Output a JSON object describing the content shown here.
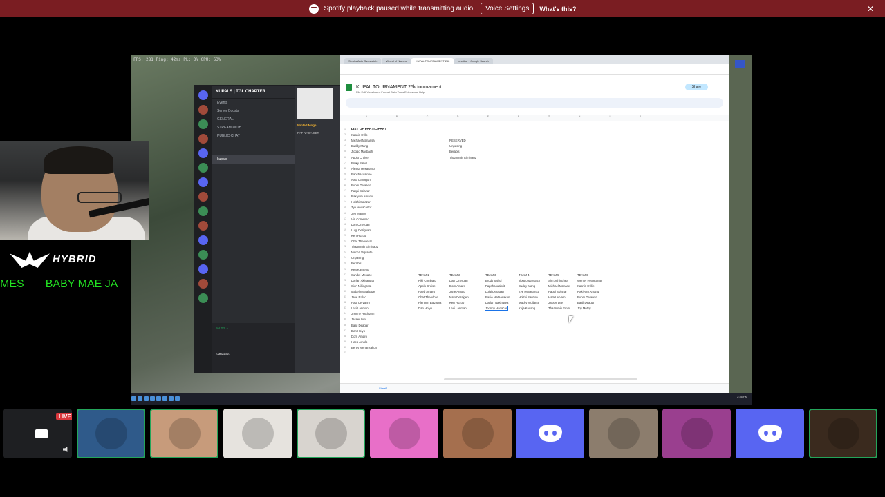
{
  "notice": {
    "message": "Spotify playback paused while transmitting audio.",
    "button_label": "Voice Settings",
    "link_label": "What's this?",
    "close_label": "✕"
  },
  "stream": {
    "stats_text": "FPS: 281    Ping: 42ms    PL: 3%    CPU: 63%",
    "discord": {
      "server_name": "KUPALS | TGL CHAPTER",
      "channels": [
        "Events",
        "Server Boosts",
        "GENERAL",
        "STREAM-WITH",
        "PUBLIC-CHAT",
        "kupals"
      ],
      "chat_lines": [
        {
          "author": "Minted Moga",
          "text": "PAT NASA SER"
        }
      ],
      "user_status": "Screen 1",
      "username": "nattalalan"
    },
    "sheets": {
      "browser_tabs": [
        "Scrolls Auto Overwatch",
        "Wheel of Names",
        "KUPAL TOURNAMENT 25k",
        "chatbar - Google Search"
      ],
      "doc_title": "KUPAL TOURNAMENT 25k tournament",
      "menu": "File  Edit  View  Insert  Format  Data  Tools  Extensions  Help",
      "share_label": "Share",
      "columns": [
        "A",
        "B",
        "C",
        "D",
        "E",
        "F",
        "G",
        "H",
        "I",
        "J"
      ],
      "list_header": "LIST OF PARTICIPANT",
      "participants": [
        "Kasnin Evils",
        "Michael Manansa",
        "Buddy Mang",
        "Jioggo Maybach",
        "Apolo Cruise",
        "Bruky Sabul",
        "Alessa Hexacanct",
        "Papshasualone",
        "Nato Danagon",
        "Buom Delaado",
        "Paqui Salazar",
        "Rakiyom Amanu",
        "Holzhi Salazar",
        "Zye Hexacartor",
        "Jeo Matsoy",
        "Vin Cornesso",
        "Dan Cinergan",
        "Luigi Derignam",
        "Ken Hozoo",
        "Chat Theoderal",
        "Thaanimin Eiminaoz",
        "Mecha Vigilante",
        "Unpasing",
        "Berabis",
        "Kea Kasseng",
        "Sundei Menace",
        "Darlan Akinagtha",
        "Sion Nikingreta",
        "Mabelma Salvade",
        "Jane Rolad",
        "Hata Lervanm",
        "Lexi Lanman",
        "Jhonny Hashtanh",
        "Jasser Lim",
        "Basil Deagar",
        "Dan Holyo",
        "Dorn Amaro",
        "Haeo Amolo",
        "Benry Menansakon"
      ],
      "reserved_header": "RESERVED",
      "reserved": [
        "Unpasing",
        "Berabis",
        "Thaanimin Eiminaoz"
      ],
      "teams": [
        {
          "name": "TEAM 1",
          "members": [
            "Riki Combalo",
            "Apolo Cruise",
            "Haeb Amaru",
            "Chat Theodore",
            "Plenmin Balzama",
            "Dan Holyo"
          ]
        },
        {
          "name": "TEAM 2",
          "members": [
            "Dan Cinergan",
            "Dorn Amaro",
            "Jane Amolo",
            "Nato Derajgen",
            "Ken Hozoo",
            "Lexi Lanman"
          ]
        },
        {
          "name": "TEAM 3",
          "members": [
            "Brody Sahul",
            "Papshasualolit",
            "Luigi Deragan",
            "Basie Mataasakon",
            "Darlan Nakingrea",
            "Jhonny Hanacan"
          ]
        },
        {
          "name": "TEAM 4",
          "members": [
            "Jioggo Maybach",
            "Buddy Mang",
            "Zye Hexacartst",
            "Holzhi Sauzon",
            "Macky Vigilante",
            "Kuja Kessng"
          ]
        },
        {
          "name": "TEAM 5",
          "members": [
            "Sim Achinghea",
            "Michael Manase",
            "Paqui Solazar",
            "Hata Lervam",
            "Jasser Lee",
            "Thaanimin Emin"
          ]
        },
        {
          "name": "TEAM 6",
          "members": [
            "Wenby Hexacanar",
            "Kasnin Evilie",
            "Rakiyom Amanu",
            "Buom Delaudo",
            "Basil Deagar",
            "Joy Metoy"
          ]
        }
      ],
      "sheet_tab": "Sheet1"
    },
    "taskbar_clock": "2:36 PM"
  },
  "branding": {
    "logo_text": "HYBRID",
    "ticker_text": "MES       BABY MAE JA"
  },
  "participants_strip": {
    "live_badge": "LIVE",
    "tiles": [
      {
        "kind": "stream",
        "speaking": false
      },
      {
        "kind": "avatar",
        "color": "#2f5a8a",
        "speaking": true
      },
      {
        "kind": "avatar",
        "color": "#c79b7b",
        "speaking": true
      },
      {
        "kind": "avatar",
        "color": "#e6e3de",
        "speaking": false
      },
      {
        "kind": "avatar",
        "color": "#d8d4cf",
        "speaking": true
      },
      {
        "kind": "avatar",
        "color": "#e86fc8",
        "speaking": false
      },
      {
        "kind": "avatar",
        "color": "#a56f4e",
        "speaking": false
      },
      {
        "kind": "discord",
        "speaking": false
      },
      {
        "kind": "avatar",
        "color": "#8c7d6d",
        "speaking": false
      },
      {
        "kind": "avatar",
        "color": "#9a3f8f",
        "speaking": false
      },
      {
        "kind": "discord",
        "speaking": false
      },
      {
        "kind": "avatar",
        "color": "#3a2a1e",
        "speaking": true
      }
    ]
  }
}
